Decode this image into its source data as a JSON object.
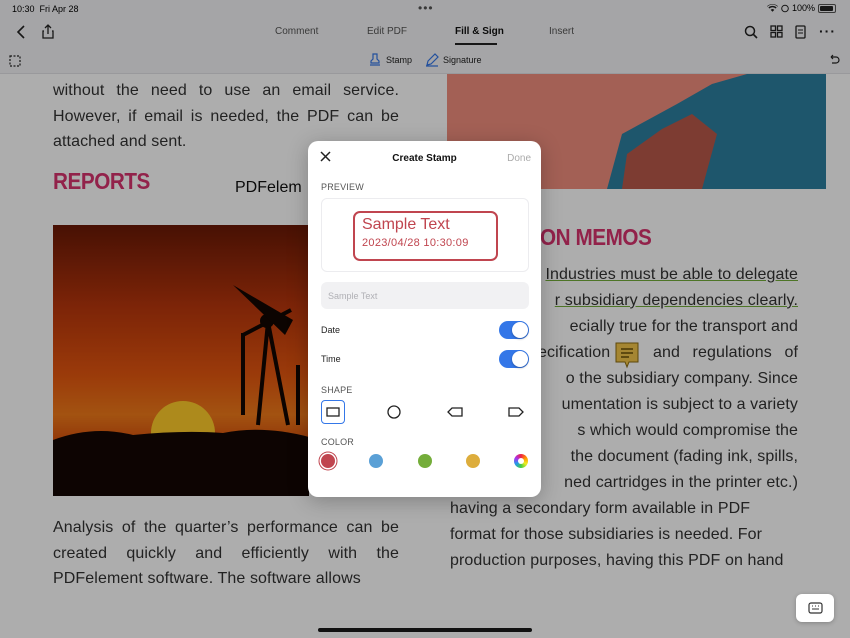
{
  "status": {
    "time": "10:30",
    "date": "Fri Apr 28",
    "battery": "100%"
  },
  "toolbar": {
    "tabs": [
      {
        "label": "Comment"
      },
      {
        "label": "Edit PDF"
      },
      {
        "label": "Fill & Sign"
      },
      {
        "label": "Insert"
      }
    ],
    "active": "Fill & Sign"
  },
  "subbar": {
    "stamp_label": "Stamp",
    "signature_label": "Signature"
  },
  "document": {
    "para_top": "without the need to use an email service. However, if email is needed, the PDF can be attached and sent.",
    "reports_heading": "REPORTS",
    "floating_text": "PDFelem",
    "memos_heading": "ON MEMOS",
    "memo_lines": [
      "Industries must be able to delegate",
      "r subsidiary dependencies clearly.",
      "ecially true for the transport and",
      "ecification",
      "and regulations of",
      "o the subsidiary company. Since",
      "umentation is subject to a variety",
      "s which would compromise the",
      "the document (fading ink, spills,",
      "ned cartridges in the printer etc.)",
      "having a secondary form available in PDF",
      "format for those subsidiaries is needed. For",
      "production purposes, having this PDF on hand"
    ],
    "para_bottom": "Analysis of the quarter’s performance can be created quickly and efficiently with the PDFelement software. The software allows"
  },
  "modal": {
    "title": "Create Stamp",
    "done_label": "Done",
    "preview_label": "PREVIEW",
    "stamp_text": "Sample Text",
    "stamp_datetime": "2023/04/28 10:30:09",
    "input_placeholder": "Sample Text",
    "date_label": "Date",
    "time_label": "Time",
    "shape_label": "SHAPE",
    "color_label": "COLOR",
    "shapes": [
      "rectangle",
      "circle",
      "arrow-left",
      "arrow-right"
    ],
    "colors": [
      "#c0454f",
      "#5aa0d6",
      "#74ad3a",
      "#ddad3c",
      "rainbow"
    ],
    "selected_color": "#c0454f"
  },
  "colors": {
    "accent": "#3477e8",
    "heading": "#d8336e",
    "stamp": "#c0454f"
  }
}
